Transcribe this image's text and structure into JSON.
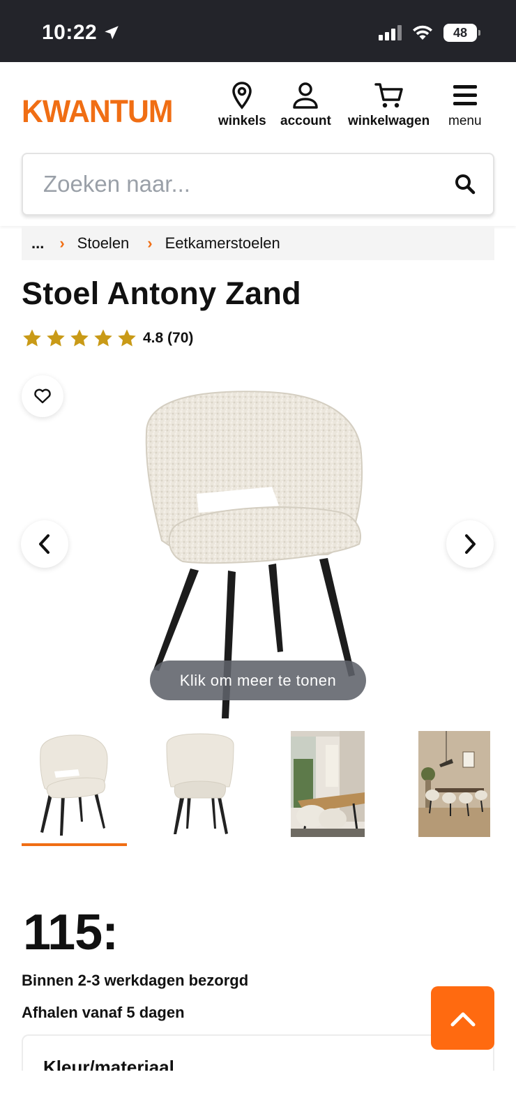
{
  "status_bar": {
    "time": "10:22",
    "battery": "48"
  },
  "header": {
    "logo": "KWANTUM",
    "nav": [
      {
        "label": "winkels",
        "icon": "location-pin-icon"
      },
      {
        "label": "account",
        "icon": "user-icon"
      },
      {
        "label": "winkelwagen",
        "icon": "cart-icon"
      },
      {
        "label": "menu",
        "icon": "hamburger-menu-icon"
      }
    ]
  },
  "search": {
    "placeholder": "Zoeken naar..."
  },
  "breadcrumb": {
    "ellipsis": "...",
    "items": [
      "Stoelen",
      "Eetkamerstoelen"
    ]
  },
  "product": {
    "title": "Stoel Antony Zand",
    "rating_text": "4.8 (70)",
    "rating": 4.8,
    "stars": 5,
    "show_more": "Klik om meer te tonen",
    "price": "115:",
    "delivery": "Binnen 2-3 werkdagen bezorgd",
    "pickup": "Afhalen vanaf 5 dagen",
    "option_label": "Kleur/materiaal"
  },
  "colors": {
    "brand": "#f06e14",
    "star": "#c99a17",
    "status_bg": "#23242a"
  }
}
